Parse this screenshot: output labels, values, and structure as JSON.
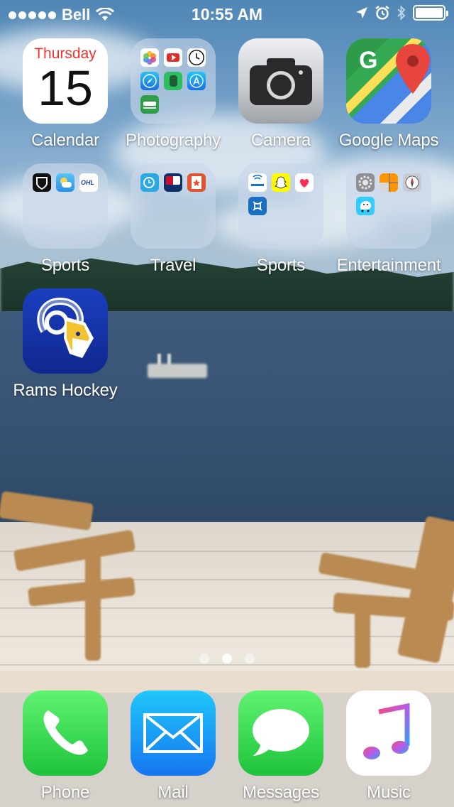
{
  "status_bar": {
    "carrier": "Bell",
    "time": "10:55 AM",
    "battery_level": 1.0
  },
  "apps": {
    "calendar": {
      "label": "Calendar",
      "day": "Thursday",
      "date": "15"
    },
    "photography": {
      "label": "Photography"
    },
    "camera": {
      "label": "Camera"
    },
    "google_maps": {
      "label": "Google Maps"
    },
    "sports_1": {
      "label": "Sports"
    },
    "travel": {
      "label": "Travel"
    },
    "sports_2": {
      "label": "Sports"
    },
    "entertainment": {
      "label": "Entertainment"
    },
    "rams_hockey": {
      "label": "Rams Hockey"
    }
  },
  "page_indicator": {
    "count": 3,
    "current": 2
  },
  "dock": {
    "phone": {
      "label": "Phone"
    },
    "mail": {
      "label": "Mail"
    },
    "messages": {
      "label": "Messages"
    },
    "music": {
      "label": "Music"
    }
  },
  "colors": {
    "calendar_red": "#f0352d",
    "phone_green": "#2fd158",
    "mail_blue": "#1a82f7",
    "folder_tint": "#c8d7e8"
  }
}
